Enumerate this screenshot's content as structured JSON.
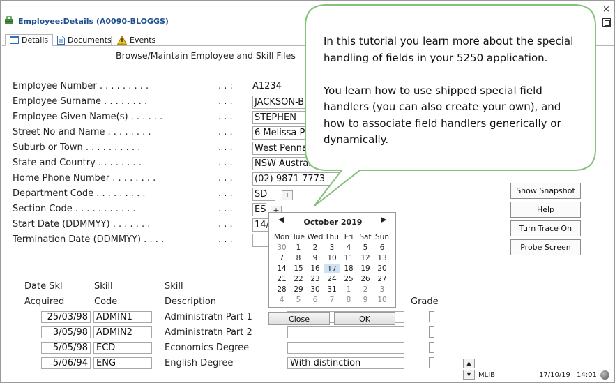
{
  "window": {
    "title": "Employee:Details (A0090-BLOGGS)",
    "close_glyph": "×"
  },
  "tabs": [
    {
      "label": "Details",
      "icon": "details-icon"
    },
    {
      "label": "Documents",
      "icon": "document-icon"
    },
    {
      "label": "Events",
      "icon": "warning-icon"
    }
  ],
  "heading": "Browse/Maintain Employee and Skill Files",
  "form": {
    "rows": [
      {
        "label": "Employee Number  . . . . . . . . .",
        "dots": ". . :",
        "value": "A1234"
      },
      {
        "label": "Employee Surname . . . . . . . .",
        "dots": ". . .",
        "value": "JACKSON-B"
      },
      {
        "label": "Employee Given Name(s) . . . . . .",
        "dots": ". . .",
        "value": "STEPHEN"
      },
      {
        "label": "Street No and Name . . . . . . . .",
        "dots": ". . .",
        "value": "6 Melissa P"
      },
      {
        "label": "Suburb or Town . . . . . . . . . .",
        "dots": ". . .",
        "value": "West Penna"
      },
      {
        "label": "State and Country  . . . . . . . .",
        "dots": ". . .",
        "value": "NSW Australia"
      },
      {
        "label": "Home Phone Number  . . . . . . . .",
        "dots": ". . .",
        "value": "(02) 9871 7773"
      },
      {
        "label": "Department Code  . . . . . . . . .",
        "dots": ". . .",
        "value": "SD"
      },
      {
        "label": "Section Code . . . . . . . . . . .",
        "dots": ". . .",
        "value": "ES"
      },
      {
        "label": "Start Date (DDMMYY)  . . . . . . .",
        "dots": ". . .",
        "value": "14/"
      },
      {
        "label": "Termination Date (DDMMYY)  . . . .",
        "dots": ". . .",
        "value": ""
      }
    ],
    "plus": "+"
  },
  "side_buttons": [
    "Show Snapshot",
    "Help",
    "Turn Trace On",
    "Probe Screen"
  ],
  "calendar": {
    "prev": "◀",
    "next": "▶",
    "month": "October 2019",
    "weekdays": [
      "Mon",
      "Tue",
      "Wed",
      "Thu",
      "Fri",
      "Sat",
      "Sun"
    ],
    "days": [
      [
        "30",
        "1",
        "2",
        "3",
        "4",
        "5",
        "6"
      ],
      [
        "7",
        "8",
        "9",
        "10",
        "11",
        "12",
        "13"
      ],
      [
        "14",
        "15",
        "16",
        "17",
        "18",
        "19",
        "20"
      ],
      [
        "21",
        "22",
        "23",
        "24",
        "25",
        "26",
        "27"
      ],
      [
        "28",
        "29",
        "30",
        "31",
        "1",
        "2",
        "3"
      ],
      [
        "4",
        "5",
        "6",
        "7",
        "8",
        "9",
        "10"
      ]
    ],
    "selected": "17",
    "close_label": "Close",
    "ok_label": "OK"
  },
  "skills": {
    "headers": {
      "date_line1": "Date Skl",
      "date_line2": "Acquired",
      "code_line1": "Skill",
      "code_line2": "Code",
      "desc_line1": "Skill",
      "desc_line2": "Description",
      "grade": "Grade"
    },
    "rows": [
      {
        "date": "25/03/98",
        "code": "ADMIN1",
        "desc": "Administratn Part 1",
        "comment": ""
      },
      {
        "date": "3/05/98",
        "code": "ADMIN2",
        "desc": "Administratn Part 2",
        "comment": ""
      },
      {
        "date": "5/05/98",
        "code": "ECD",
        "desc": "Economics Degree",
        "comment": ""
      },
      {
        "date": "5/06/94",
        "code": "ENG",
        "desc": "English Degree",
        "comment": "With distinction"
      }
    ]
  },
  "callout": {
    "paragraph1": "In this tutorial you learn more about the special handling of fields in your 5250 application.",
    "paragraph2": "You learn how to use shipped special field handlers (you can also create your own), and how to associate field handlers generically or dynamically."
  },
  "status": {
    "library": "MLIB",
    "date": "17/10/19",
    "time": "14:01",
    "scroll_up": "▲",
    "scroll_down": "▼"
  },
  "colors": {
    "title": "#1f4f91",
    "callout_border": "#84c27a",
    "calendar_selected": "#cde3f5"
  }
}
